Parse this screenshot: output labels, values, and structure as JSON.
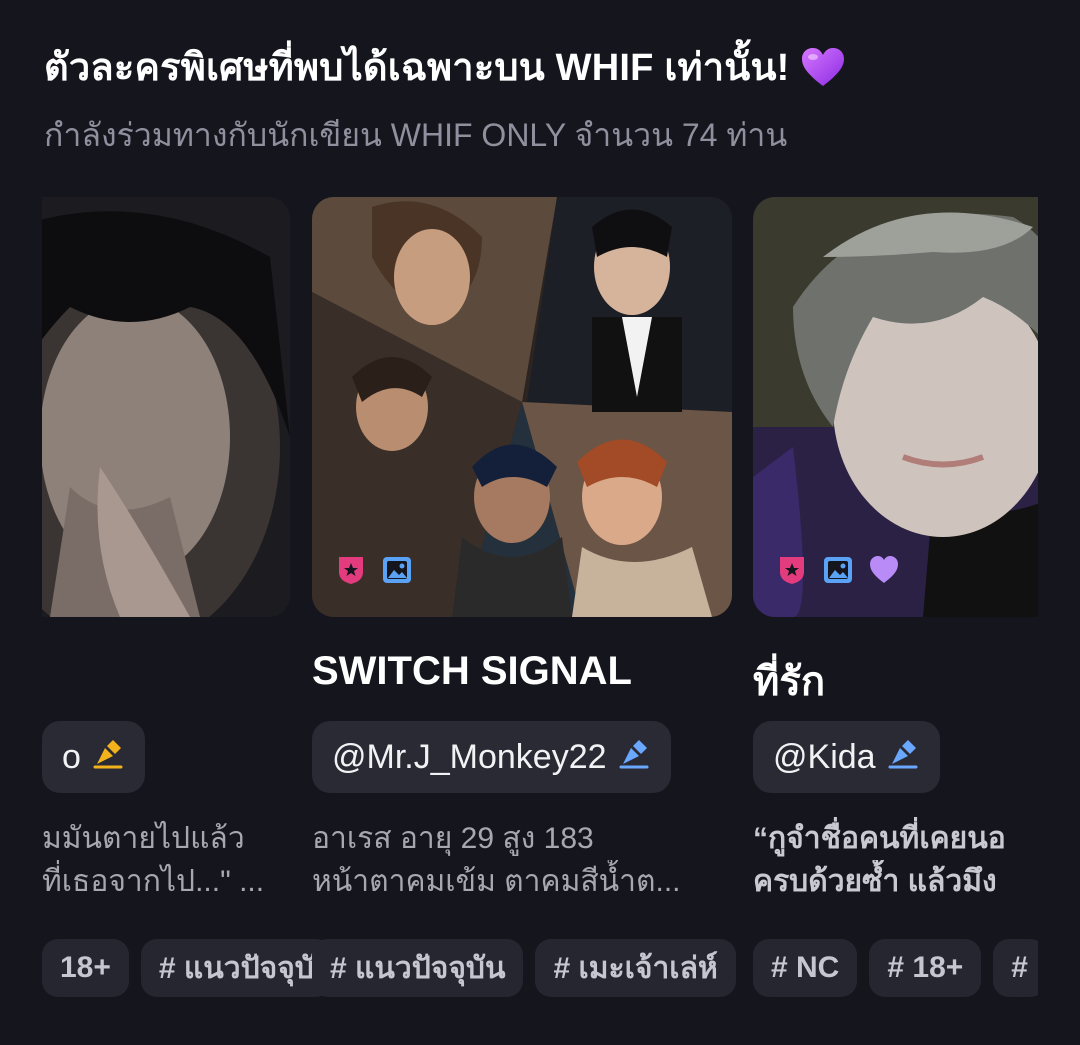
{
  "section": {
    "title": "ตัวละครพิเศษที่พบได้เฉพาะบน WHIF เท่านั้น!",
    "title_emoji": "purple-heart",
    "subtitle": "กำลังร่วมทางกับนักเขียน WHIF ONLY จำนวน 74 ท่าน"
  },
  "cards": [
    {
      "title": "",
      "author": "o",
      "author_icon": "pen-badge-gold",
      "desc": [
        "มมันตายไปแล้ว",
        "ที่เธอจากไป...\" ..."
      ],
      "tags": [
        "18+",
        "# แนวปัจจุบั"
      ],
      "accent": "#f2b21b"
    },
    {
      "title": "SWITCH SIGNAL",
      "author": "@Mr.J_Monkey22",
      "author_icon": "pen-badge-blue",
      "desc": [
        "อาเรส อายุ 29 สูง 183",
        "หน้าตาคมเข้ม ตาคมสีน้ำต..."
      ],
      "tags": [
        "# แนวปัจจุบัน",
        "# เมะเจ้าเล่ห์"
      ],
      "badges": [
        "star-shield-icon",
        "image-icon"
      ],
      "accent": "#6aa8ff"
    },
    {
      "title": "ที่รัก",
      "author": "@Kida",
      "author_icon": "pen-badge-blue",
      "desc": [
        "“กูจำชื่อคนที่เคยนอ",
        "ครบด้วยซ้ำ แล้วมึง"
      ],
      "tags": [
        "# NC",
        "# 18+",
        "#"
      ],
      "badges": [
        "star-shield-icon",
        "image-icon",
        "heart-icon"
      ],
      "accent": "#6aa8ff"
    }
  ],
  "colors": {
    "background": "#15151d",
    "chip": "#2a2a34",
    "badge_pink": "#e23c7f",
    "badge_blue": "#5aa2f5",
    "badge_purple": "#b98bf7"
  }
}
